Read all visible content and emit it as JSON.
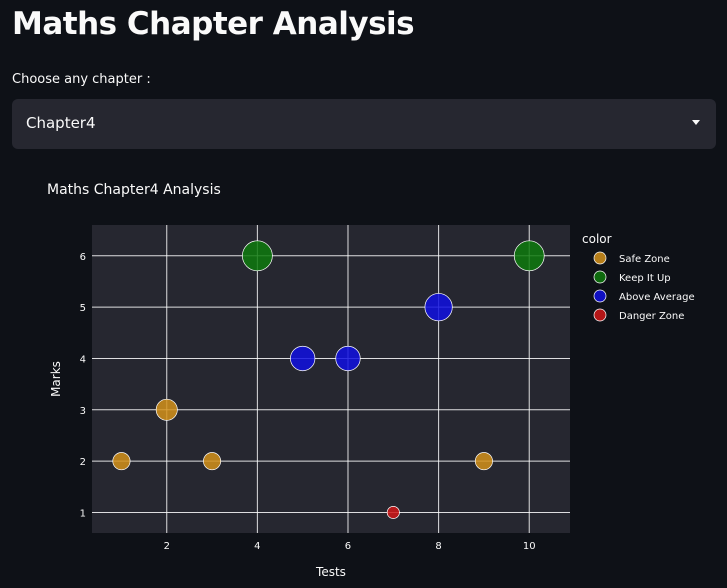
{
  "page": {
    "title": "Maths Chapter Analysis"
  },
  "chapter_select": {
    "label": "Choose any chapter :",
    "value": "Chapter4"
  },
  "theme": {
    "background": "#0e1117",
    "plot_background": "#262730",
    "grid_color": "#ffffff"
  },
  "chart_data": {
    "type": "scatter",
    "title": "Maths Chapter4 Analysis",
    "xlabel": "Tests",
    "ylabel": "Marks",
    "xlim": [
      0.35,
      10.9
    ],
    "ylim": [
      0.6,
      6.6
    ],
    "xticks": [
      2,
      4,
      6,
      8,
      10
    ],
    "yticks": [
      1,
      2,
      3,
      4,
      5,
      6
    ],
    "grid": true,
    "marker_size_encodes": "Marks",
    "legend": {
      "title": "color",
      "position": "right"
    },
    "series": [
      {
        "name": "Safe Zone",
        "color": "#d4921a",
        "points": [
          {
            "x": 1,
            "y": 2
          },
          {
            "x": 2,
            "y": 3
          },
          {
            "x": 3,
            "y": 2
          },
          {
            "x": 9,
            "y": 2
          }
        ]
      },
      {
        "name": "Keep It Up",
        "color": "#0e7a0d",
        "points": [
          {
            "x": 4,
            "y": 6
          },
          {
            "x": 10,
            "y": 6
          }
        ]
      },
      {
        "name": "Above Average",
        "color": "#1010e0",
        "points": [
          {
            "x": 5,
            "y": 4
          },
          {
            "x": 6,
            "y": 4
          },
          {
            "x": 8,
            "y": 5
          }
        ]
      },
      {
        "name": "Danger Zone",
        "color": "#d01818",
        "points": [
          {
            "x": 7,
            "y": 1
          }
        ]
      }
    ]
  }
}
